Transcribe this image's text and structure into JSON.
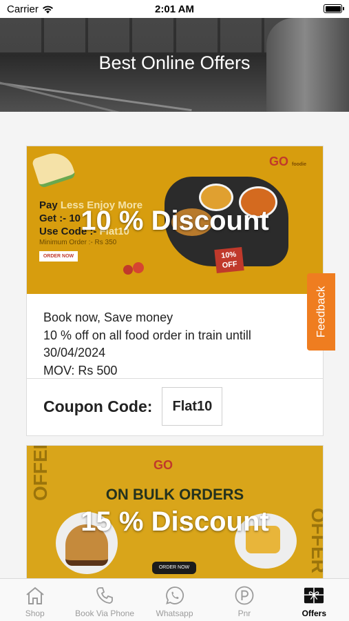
{
  "status_bar": {
    "carrier": "Carrier",
    "time": "2:01 AM"
  },
  "header": {
    "title": "Best Online Offers"
  },
  "offers": [
    {
      "discount": "10 % Discount",
      "banner": {
        "tagline_line1_a": "Pay ",
        "tagline_line1_b": "Less Enjoy More",
        "tagline_line2": "Get :- 10",
        "tagline_line3_a": "Use Code :- ",
        "tagline_line3_b": "Flat10",
        "min_order": "Minimum Order :- Rs 350",
        "order_now": "ORDER NOW",
        "badge_line1": "10%",
        "badge_line2": "OFF",
        "logo": "GO",
        "logo_sub": "foodie"
      },
      "description_lines": [
        "Book now, Save money",
        "10 % off on all food order in train untill",
        "30/04/2024",
        "MOV: Rs 500"
      ],
      "coupon_label": "Coupon Code:",
      "coupon_code": "Flat10"
    },
    {
      "discount": "15 % Discount",
      "banner": {
        "logo": "GO",
        "headline": "ON BULK ORDERS",
        "side_text": "OFFER",
        "order_now": "ORDER NOW"
      }
    }
  ],
  "feedback_label": "Feedback",
  "tabs": [
    {
      "label": "Shop",
      "icon": "home-icon",
      "active": false
    },
    {
      "label": "Book Via Phone",
      "icon": "phone-icon",
      "active": false
    },
    {
      "label": "Whatsapp",
      "icon": "whatsapp-icon",
      "active": false
    },
    {
      "label": "Pnr",
      "icon": "parking-p-icon",
      "active": false
    },
    {
      "label": "Offers",
      "icon": "gift-icon",
      "active": true
    }
  ],
  "colors": {
    "accent": "#ef7d20",
    "banner_yellow": "#d79d0e",
    "tab_inactive": "#9b9b9b"
  }
}
